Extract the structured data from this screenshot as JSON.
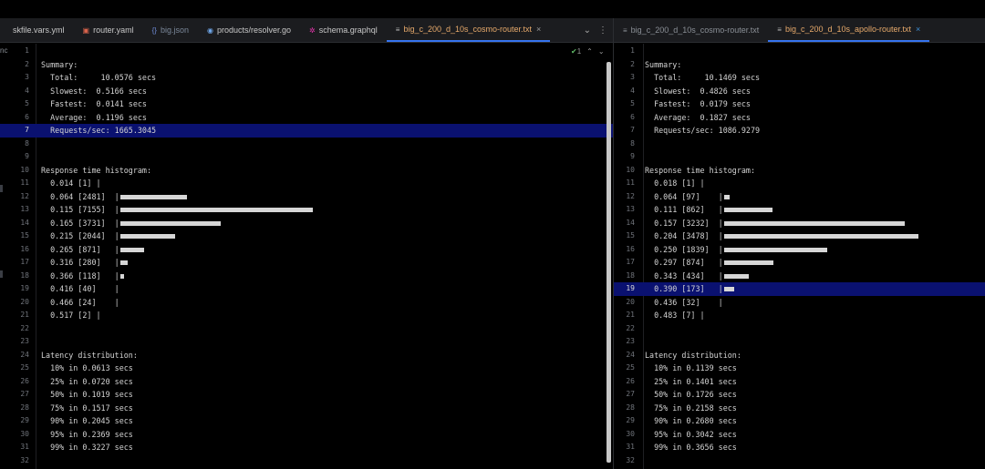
{
  "left_tabs": [
    {
      "label": "skfile.vars.yml",
      "icon": "yaml-file-icon",
      "icon_glyph": "",
      "color": "#c8c8c8",
      "icon_color": "#c8c8c8",
      "active": false
    },
    {
      "label": "router.yaml",
      "icon": "yaml-file-icon",
      "icon_glyph": "▣",
      "color": "#c8c8c8",
      "icon_color": "#d9634c",
      "active": false
    },
    {
      "label": "big.json",
      "icon": "json-file-icon",
      "icon_glyph": "{}",
      "color": "#7a8799",
      "icon_color": "#6f8bd6",
      "active": false
    },
    {
      "label": "products/resolver.go",
      "icon": "go-file-icon",
      "icon_glyph": "◉",
      "color": "#c8c8c8",
      "icon_color": "#6fa6e8",
      "active": false
    },
    {
      "label": "schema.graphql",
      "icon": "graphql-file-icon",
      "icon_glyph": "✲",
      "color": "#c8c8c8",
      "icon_color": "#e535ab",
      "active": false
    },
    {
      "label": "big_c_200_d_10s_cosmo-router.txt",
      "icon": "text-file-icon",
      "icon_glyph": "≡",
      "color": "#e6a96b",
      "icon_color": "#b5b5b5",
      "active": true
    }
  ],
  "right_tabs": [
    {
      "label": "big_c_200_d_10s_cosmo-router.txt",
      "icon": "text-file-icon",
      "icon_glyph": "≡",
      "color": "#8a8f96",
      "icon_color": "#8a8f96",
      "active": false
    },
    {
      "label": "big_c_200_d_10s_apollo-router.txt",
      "icon": "text-file-icon",
      "icon_glyph": "≡",
      "color": "#e6a96b",
      "icon_color": "#b5b5b5",
      "active": true
    }
  ],
  "controls": {
    "close_glyph": "×",
    "menu_glyph": "⌄",
    "more_glyph": "⋮",
    "inspection_ok_glyph": "✔",
    "inspection_count": "1",
    "prev_glyph": "⌃",
    "next_glyph": "⌄",
    "edge_glyph": "nc"
  },
  "left_editor": {
    "highlighted_line": 7,
    "lines": [
      {
        "n": "1",
        "t": "",
        "bar": 0
      },
      {
        "n": "2",
        "t": "Summary:",
        "bar": 0
      },
      {
        "n": "3",
        "t": "  Total:     10.0576 secs",
        "bar": 0
      },
      {
        "n": "4",
        "t": "  Slowest:  0.5166 secs",
        "bar": 0
      },
      {
        "n": "5",
        "t": "  Fastest:  0.0141 secs",
        "bar": 0
      },
      {
        "n": "6",
        "t": "  Average:  0.1196 secs",
        "bar": 0
      },
      {
        "n": "7",
        "t": "  Requests/sec: 1665.3045",
        "bar": 0
      },
      {
        "n": "8",
        "t": "",
        "bar": 0
      },
      {
        "n": "9",
        "t": "",
        "bar": 0
      },
      {
        "n": "10",
        "t": "Response time histogram:",
        "bar": 0
      },
      {
        "n": "11",
        "t": "  0.014 [1] |",
        "bar": 0
      },
      {
        "n": "12",
        "t": "  0.064 [2481]  |",
        "bar": 2481
      },
      {
        "n": "13",
        "t": "  0.115 [7155]  |",
        "bar": 7155
      },
      {
        "n": "14",
        "t": "  0.165 [3731]  |",
        "bar": 3731
      },
      {
        "n": "15",
        "t": "  0.215 [2044]  |",
        "bar": 2044
      },
      {
        "n": "16",
        "t": "  0.265 [871]   |",
        "bar": 871
      },
      {
        "n": "17",
        "t": "  0.316 [280]   |",
        "bar": 280
      },
      {
        "n": "18",
        "t": "  0.366 [118]   |",
        "bar": 118
      },
      {
        "n": "19",
        "t": "  0.416 [40]    |",
        "bar": 0
      },
      {
        "n": "20",
        "t": "  0.466 [24]    |",
        "bar": 0
      },
      {
        "n": "21",
        "t": "  0.517 [2] |",
        "bar": 0
      },
      {
        "n": "22",
        "t": "",
        "bar": 0
      },
      {
        "n": "23",
        "t": "",
        "bar": 0
      },
      {
        "n": "24",
        "t": "Latency distribution:",
        "bar": 0
      },
      {
        "n": "25",
        "t": "  10% in 0.0613 secs",
        "bar": 0
      },
      {
        "n": "26",
        "t": "  25% in 0.0720 secs",
        "bar": 0
      },
      {
        "n": "27",
        "t": "  50% in 0.1019 secs",
        "bar": 0
      },
      {
        "n": "28",
        "t": "  75% in 0.1517 secs",
        "bar": 0
      },
      {
        "n": "29",
        "t": "  90% in 0.2045 secs",
        "bar": 0
      },
      {
        "n": "30",
        "t": "  95% in 0.2369 secs",
        "bar": 0
      },
      {
        "n": "31",
        "t": "  99% in 0.3227 secs",
        "bar": 0
      },
      {
        "n": "32",
        "t": "",
        "bar": 0
      }
    ]
  },
  "right_editor": {
    "highlighted_line": 19,
    "lines": [
      {
        "n": "1",
        "t": "",
        "bar": 0
      },
      {
        "n": "2",
        "t": "Summary:",
        "bar": 0
      },
      {
        "n": "3",
        "t": "  Total:     10.1469 secs",
        "bar": 0
      },
      {
        "n": "4",
        "t": "  Slowest:  0.4826 secs",
        "bar": 0
      },
      {
        "n": "5",
        "t": "  Fastest:  0.0179 secs",
        "bar": 0
      },
      {
        "n": "6",
        "t": "  Average:  0.1827 secs",
        "bar": 0
      },
      {
        "n": "7",
        "t": "  Requests/sec: 1086.9279",
        "bar": 0
      },
      {
        "n": "8",
        "t": "",
        "bar": 0
      },
      {
        "n": "9",
        "t": "",
        "bar": 0
      },
      {
        "n": "10",
        "t": "Response time histogram:",
        "bar": 0
      },
      {
        "n": "11",
        "t": "  0.018 [1] |",
        "bar": 0
      },
      {
        "n": "12",
        "t": "  0.064 [97]    |",
        "bar": 97
      },
      {
        "n": "13",
        "t": "  0.111 [862]   |",
        "bar": 862
      },
      {
        "n": "14",
        "t": "  0.157 [3232]  |",
        "bar": 3232
      },
      {
        "n": "15",
        "t": "  0.204 [3478]  |",
        "bar": 3478
      },
      {
        "n": "16",
        "t": "  0.250 [1839]  |",
        "bar": 1839
      },
      {
        "n": "17",
        "t": "  0.297 [874]   |",
        "bar": 874
      },
      {
        "n": "18",
        "t": "  0.343 [434]   |",
        "bar": 434
      },
      {
        "n": "19",
        "t": "  0.390 [173]   |",
        "bar": 173
      },
      {
        "n": "20",
        "t": "  0.436 [32]    |",
        "bar": 0
      },
      {
        "n": "21",
        "t": "  0.483 [7] |",
        "bar": 0
      },
      {
        "n": "22",
        "t": "",
        "bar": 0
      },
      {
        "n": "23",
        "t": "",
        "bar": 0
      },
      {
        "n": "24",
        "t": "Latency distribution:",
        "bar": 0
      },
      {
        "n": "25",
        "t": "  10% in 0.1139 secs",
        "bar": 0
      },
      {
        "n": "26",
        "t": "  25% in 0.1401 secs",
        "bar": 0
      },
      {
        "n": "27",
        "t": "  50% in 0.1726 secs",
        "bar": 0
      },
      {
        "n": "28",
        "t": "  75% in 0.2158 secs",
        "bar": 0
      },
      {
        "n": "29",
        "t": "  90% in 0.2680 secs",
        "bar": 0
      },
      {
        "n": "30",
        "t": "  95% in 0.3042 secs",
        "bar": 0
      },
      {
        "n": "31",
        "t": "  99% in 0.3656 secs",
        "bar": 0
      },
      {
        "n": "32",
        "t": "",
        "bar": 0
      }
    ]
  }
}
